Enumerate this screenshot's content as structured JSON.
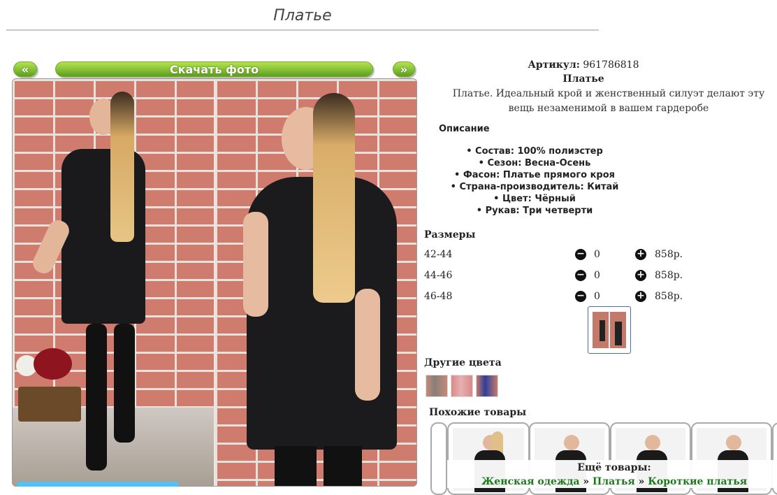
{
  "page": {
    "title": "Платье"
  },
  "gallery": {
    "prev_label": "«",
    "download_label": "Скачать фото",
    "next_label": "»"
  },
  "product": {
    "article_label": "Артикул:",
    "article_value": "961786818",
    "name": "Платье",
    "short_description": "Платье. Идеальный крой и женственный силуэт делают эту вещь незаменимой в вашем гардеробе",
    "description_heading": "Описание",
    "description_items": [
      "Состав: 100% полиэстер",
      "Сезон: Весна-Осень",
      "Фасон: Платье прямого кроя",
      "Страна-производитель: Китай",
      "Цвет: Чёрный",
      "Рукав: Три четверти"
    ]
  },
  "sizes": {
    "heading": "Размеры",
    "rows": [
      {
        "size": "42-44",
        "minus": "−",
        "qty": "0",
        "plus": "+",
        "price": "858р."
      },
      {
        "size": "44-46",
        "minus": "−",
        "qty": "0",
        "plus": "+",
        "price": "858р."
      },
      {
        "size": "46-48",
        "minus": "−",
        "qty": "0",
        "plus": "+",
        "price": "858р."
      }
    ]
  },
  "other_colors": {
    "heading": "Другие цвета"
  },
  "similar": {
    "heading": "Похожие товары"
  },
  "more": {
    "heading": "Ещё товары:",
    "crumbs": [
      "Женская одежда",
      "Платья",
      "Короткие платья"
    ],
    "separator": "»"
  }
}
